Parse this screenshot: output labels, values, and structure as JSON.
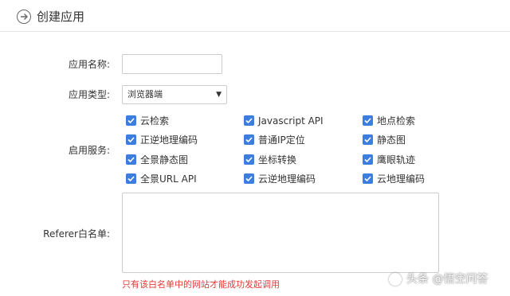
{
  "header": {
    "title": "创建应用"
  },
  "form": {
    "name_label": "应用名称:",
    "name_value": "",
    "type_label": "应用类型:",
    "type_value": "浏览器端",
    "services_label": "启用服务:",
    "services": [
      {
        "label": "云检索",
        "checked": true
      },
      {
        "label": "Javascript API",
        "checked": true
      },
      {
        "label": "地点检索",
        "checked": true
      },
      {
        "label": "正逆地理编码",
        "checked": true
      },
      {
        "label": "普通IP定位",
        "checked": true
      },
      {
        "label": "静态图",
        "checked": true
      },
      {
        "label": "全景静态图",
        "checked": true
      },
      {
        "label": "坐标转换",
        "checked": true
      },
      {
        "label": "鹰眼轨迹",
        "checked": true
      },
      {
        "label": "全景URL API",
        "checked": true
      },
      {
        "label": "云逆地理编码",
        "checked": true
      },
      {
        "label": "云地理编码",
        "checked": true
      }
    ],
    "referer_label": "Referer白名单:",
    "referer_value": "",
    "referer_hint": "只有该白名单中的网站才能成功发起调用"
  },
  "watermark": {
    "text": "头条 @悟空问答"
  },
  "colors": {
    "checkbox": "#3b7ee0",
    "hint": "#e53935"
  }
}
